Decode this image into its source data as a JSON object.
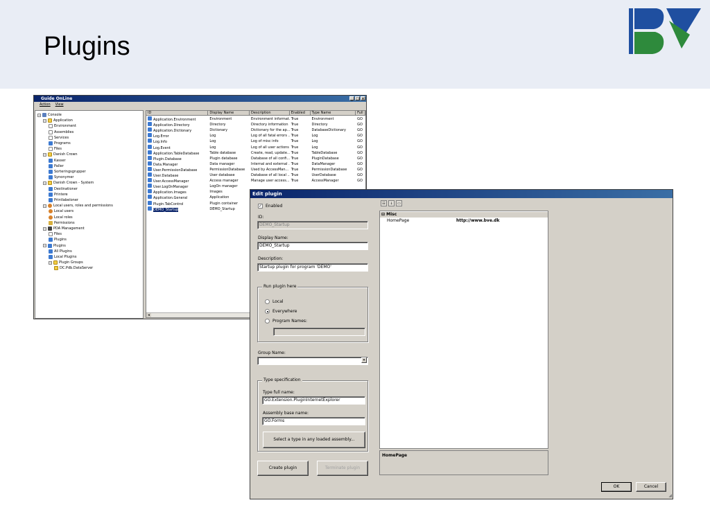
{
  "slide": {
    "title": "Plugins",
    "logo": "BVE-logo"
  },
  "guide_window": {
    "title": "Guide OnLine",
    "window_buttons": [
      "_",
      "□",
      "×"
    ],
    "menu": [
      "Action",
      "View"
    ],
    "tree": [
      {
        "label": "Console",
        "level": 0,
        "icon": "console-icon",
        "exp": "-"
      },
      {
        "label": "Application",
        "level": 1,
        "icon": "folder-icon",
        "exp": "-"
      },
      {
        "label": "Environment",
        "level": 2,
        "icon": "page-icon"
      },
      {
        "label": "Assemblies",
        "level": 2,
        "icon": "page-icon"
      },
      {
        "label": "Services",
        "level": 2,
        "icon": "gear-icon"
      },
      {
        "label": "Programs",
        "level": 2,
        "icon": "puzzle-icon"
      },
      {
        "label": "Files",
        "level": 2,
        "icon": "page-icon"
      },
      {
        "label": "Danish Crown",
        "level": 1,
        "icon": "folder-icon",
        "exp": "-"
      },
      {
        "label": "Kasser",
        "level": 2,
        "icon": "puzzle-icon"
      },
      {
        "label": "Paller",
        "level": 2,
        "icon": "puzzle-icon"
      },
      {
        "label": "Sorteringsgrupper",
        "level": 2,
        "icon": "puzzle-icon"
      },
      {
        "label": "Synonymer",
        "level": 2,
        "icon": "puzzle-icon"
      },
      {
        "label": "Danish Crown - System",
        "level": 1,
        "icon": "folder-icon",
        "exp": "-"
      },
      {
        "label": "Destinationer",
        "level": 2,
        "icon": "puzzle-icon"
      },
      {
        "label": "Printere",
        "level": 2,
        "icon": "puzzle-icon"
      },
      {
        "label": "Printlabeloner",
        "level": 2,
        "icon": "puzzle-icon"
      },
      {
        "label": "Local users, roles and permissions",
        "level": 1,
        "icon": "user-icon",
        "exp": "-"
      },
      {
        "label": "Local users",
        "level": 2,
        "icon": "user-icon"
      },
      {
        "label": "Local roles",
        "level": 2,
        "icon": "user-icon"
      },
      {
        "label": "Permissions",
        "level": 2,
        "icon": "key-icon"
      },
      {
        "label": "PDA Management",
        "level": 1,
        "icon": "pda-icon",
        "exp": "-"
      },
      {
        "label": "Files",
        "level": 2,
        "icon": "page-icon"
      },
      {
        "label": "Plugins",
        "level": 2,
        "icon": "puzzle-icon"
      },
      {
        "label": "Plugins",
        "level": 1,
        "icon": "puzzle-icon",
        "exp": "-"
      },
      {
        "label": "All Plugins",
        "level": 2,
        "icon": "puzzle-icon"
      },
      {
        "label": "Local Plugins",
        "level": 2,
        "icon": "puzzle-icon"
      },
      {
        "label": "Plugin Groups",
        "level": 2,
        "icon": "folder-icon",
        "exp": "-"
      },
      {
        "label": "DC.Pdb.DataServer",
        "level": 3,
        "icon": "folder-icon"
      }
    ],
    "columns": [
      "ID",
      "Display Name",
      "Description",
      "Enabled",
      "Type Name",
      "Full"
    ],
    "rows": [
      [
        "Application.Environment",
        "Environment",
        "Environment informat...",
        "True",
        "Environment",
        "GO"
      ],
      [
        "Application.Directory",
        "Directory",
        "Directory information",
        "True",
        "Directory",
        "GO"
      ],
      [
        "Application.Dictionary",
        "Dictionary",
        "Dictionary for the ap...",
        "True",
        "DatabaseDictionary",
        "GO"
      ],
      [
        "Log.Error",
        "Log",
        "Log of all fatal errors ...",
        "True",
        "Log",
        "GO"
      ],
      [
        "Log.Info",
        "Log",
        "Log of misc info",
        "True",
        "Log",
        "GO"
      ],
      [
        "Log.Event",
        "Log",
        "Log of all user actions",
        "True",
        "Log",
        "GO"
      ],
      [
        "Application.TableDatabase",
        "Table database",
        "Create, read, update...",
        "True",
        "TableDatabase",
        "GO"
      ],
      [
        "Plugin.Database",
        "Plugin database",
        "Database of all confi...",
        "True",
        "PluginDatabase",
        "GO"
      ],
      [
        "Data.Manager",
        "Data manager",
        "Internal and external ...",
        "True",
        "DataManager",
        "GO"
      ],
      [
        "User.PermissionDatabase",
        "PermissionDatabase",
        "Used by AccessMan...",
        "True",
        "PermissionDatabase",
        "GO"
      ],
      [
        "User.Database",
        "User database",
        "Database of all local ...",
        "True",
        "UserDatabase",
        "GO"
      ],
      [
        "User.AccessManager",
        "Access manager",
        "Manage user access...",
        "True",
        "AccessManager",
        "GO"
      ],
      [
        "User.LogOnManager",
        "LogOn manager",
        "",
        "",
        "",
        ""
      ],
      [
        "Application.Images",
        "Images",
        "",
        "",
        "",
        ""
      ],
      [
        "Application.General",
        "Application",
        "",
        "",
        "",
        ""
      ],
      [
        "Plugin.TabControl",
        "Plugin container",
        "",
        "",
        "",
        ""
      ],
      [
        "DEMO_Startup",
        "DEMO_Startup",
        "",
        "",
        "",
        ""
      ]
    ],
    "selected_row": 16
  },
  "edit_dialog": {
    "title": "Edit plugin",
    "enabled_label": "Enabled",
    "enabled_checked": true,
    "id_label": "ID:",
    "id_value": "DEMO_Startup",
    "display_name_label": "Display Name:",
    "display_name_value": "DEMO_Startup",
    "description_label": "Description:",
    "description_value": "Startup plugin for program 'DEMO'",
    "run_group_label": "Run plugin here",
    "run_options": [
      "Local",
      "Everywhere",
      "Program Names:"
    ],
    "run_selected": "Everywhere",
    "program_names_value": "",
    "group_name_label": "Group Name:",
    "group_name_value": "",
    "type_group_label": "Type specification",
    "type_full_name_label": "Type full name:",
    "type_full_name_value": "GO.Extension.PluginInternetExplorer",
    "assembly_label": "Assembly base name:",
    "assembly_value": "GO.Forms",
    "select_type_button": "Select a type in any loaded  assembly...",
    "create_button": "Create plugin",
    "terminate_button": "Terminate plugin",
    "ok_button": "OK",
    "cancel_button": "Cancel",
    "property_grid": {
      "category": "Misc",
      "rows": [
        {
          "key": "HomePage",
          "value": "http://www.bve.dk"
        }
      ],
      "description_title": "HomePage"
    }
  },
  "colors": {
    "titlebar_start": "#0a246a",
    "titlebar_end": "#3a6ea5",
    "dialog_bg": "#d4d0c8",
    "header_bg": "#e9edf5",
    "logo_blue": "#1f4fa0",
    "logo_green": "#2e8a3c"
  }
}
